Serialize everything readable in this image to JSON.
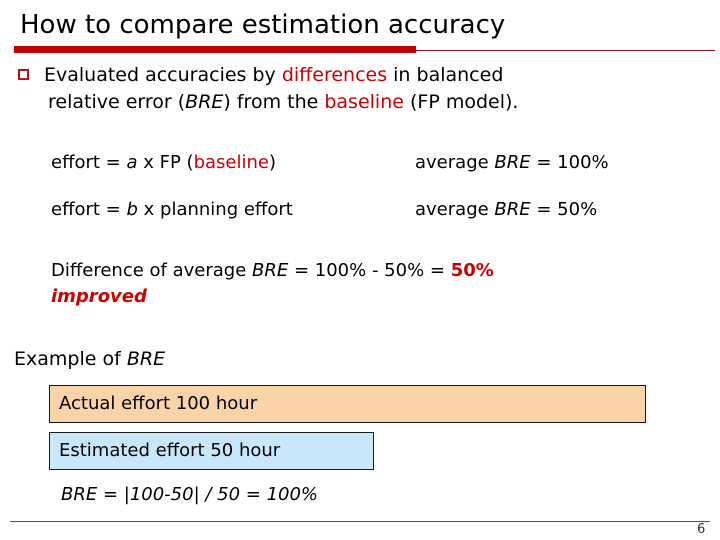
{
  "slide": {
    "title": "How to compare estimation accuracy",
    "bullet": {
      "marker": "square-bullet",
      "line1_part1": "Evaluated accuracies by ",
      "line1_highlight": "differences",
      "line1_part2": " in balanced",
      "line2_part1": "relative error (",
      "line2_italic": "BRE",
      "line2_part2": ") from the ",
      "line2_highlight": "baseline",
      "line2_part3": " (FP model)."
    },
    "rows": [
      {
        "left_part1": "effort = ",
        "left_italic": "a",
        "left_part2": " x FP (",
        "left_highlight": "baseline",
        "left_part3": ")",
        "right_part1": "average ",
        "right_italic": "BRE",
        "right_part2": " = 100%"
      },
      {
        "left_part1": "effort = ",
        "left_italic": "b",
        "left_part2": " x planning effort",
        "left_highlight": "",
        "left_part3": "",
        "right_part1": "average ",
        "right_italic": "BRE",
        "right_part2": " = 50%"
      }
    ],
    "difference": {
      "part1": "Difference of average ",
      "italic": "BRE",
      "part2": " = 100% - 50% = ",
      "highlight": "50%",
      "emphasis": "improved"
    },
    "example": {
      "label_part1": "Example of ",
      "label_italic": "BRE",
      "box_actual": "Actual effort 100 hour",
      "box_estimated": "Estimated effort 50 hour",
      "formula": "BRE = |100-50| / 50 = 100%"
    },
    "footer": {
      "page_number": "6"
    },
    "colors": {
      "accent_red": "#cc0000",
      "rule_red": "#c00000",
      "box_orange": "#fbd3a8",
      "box_blue": "#c9e7fa"
    }
  }
}
